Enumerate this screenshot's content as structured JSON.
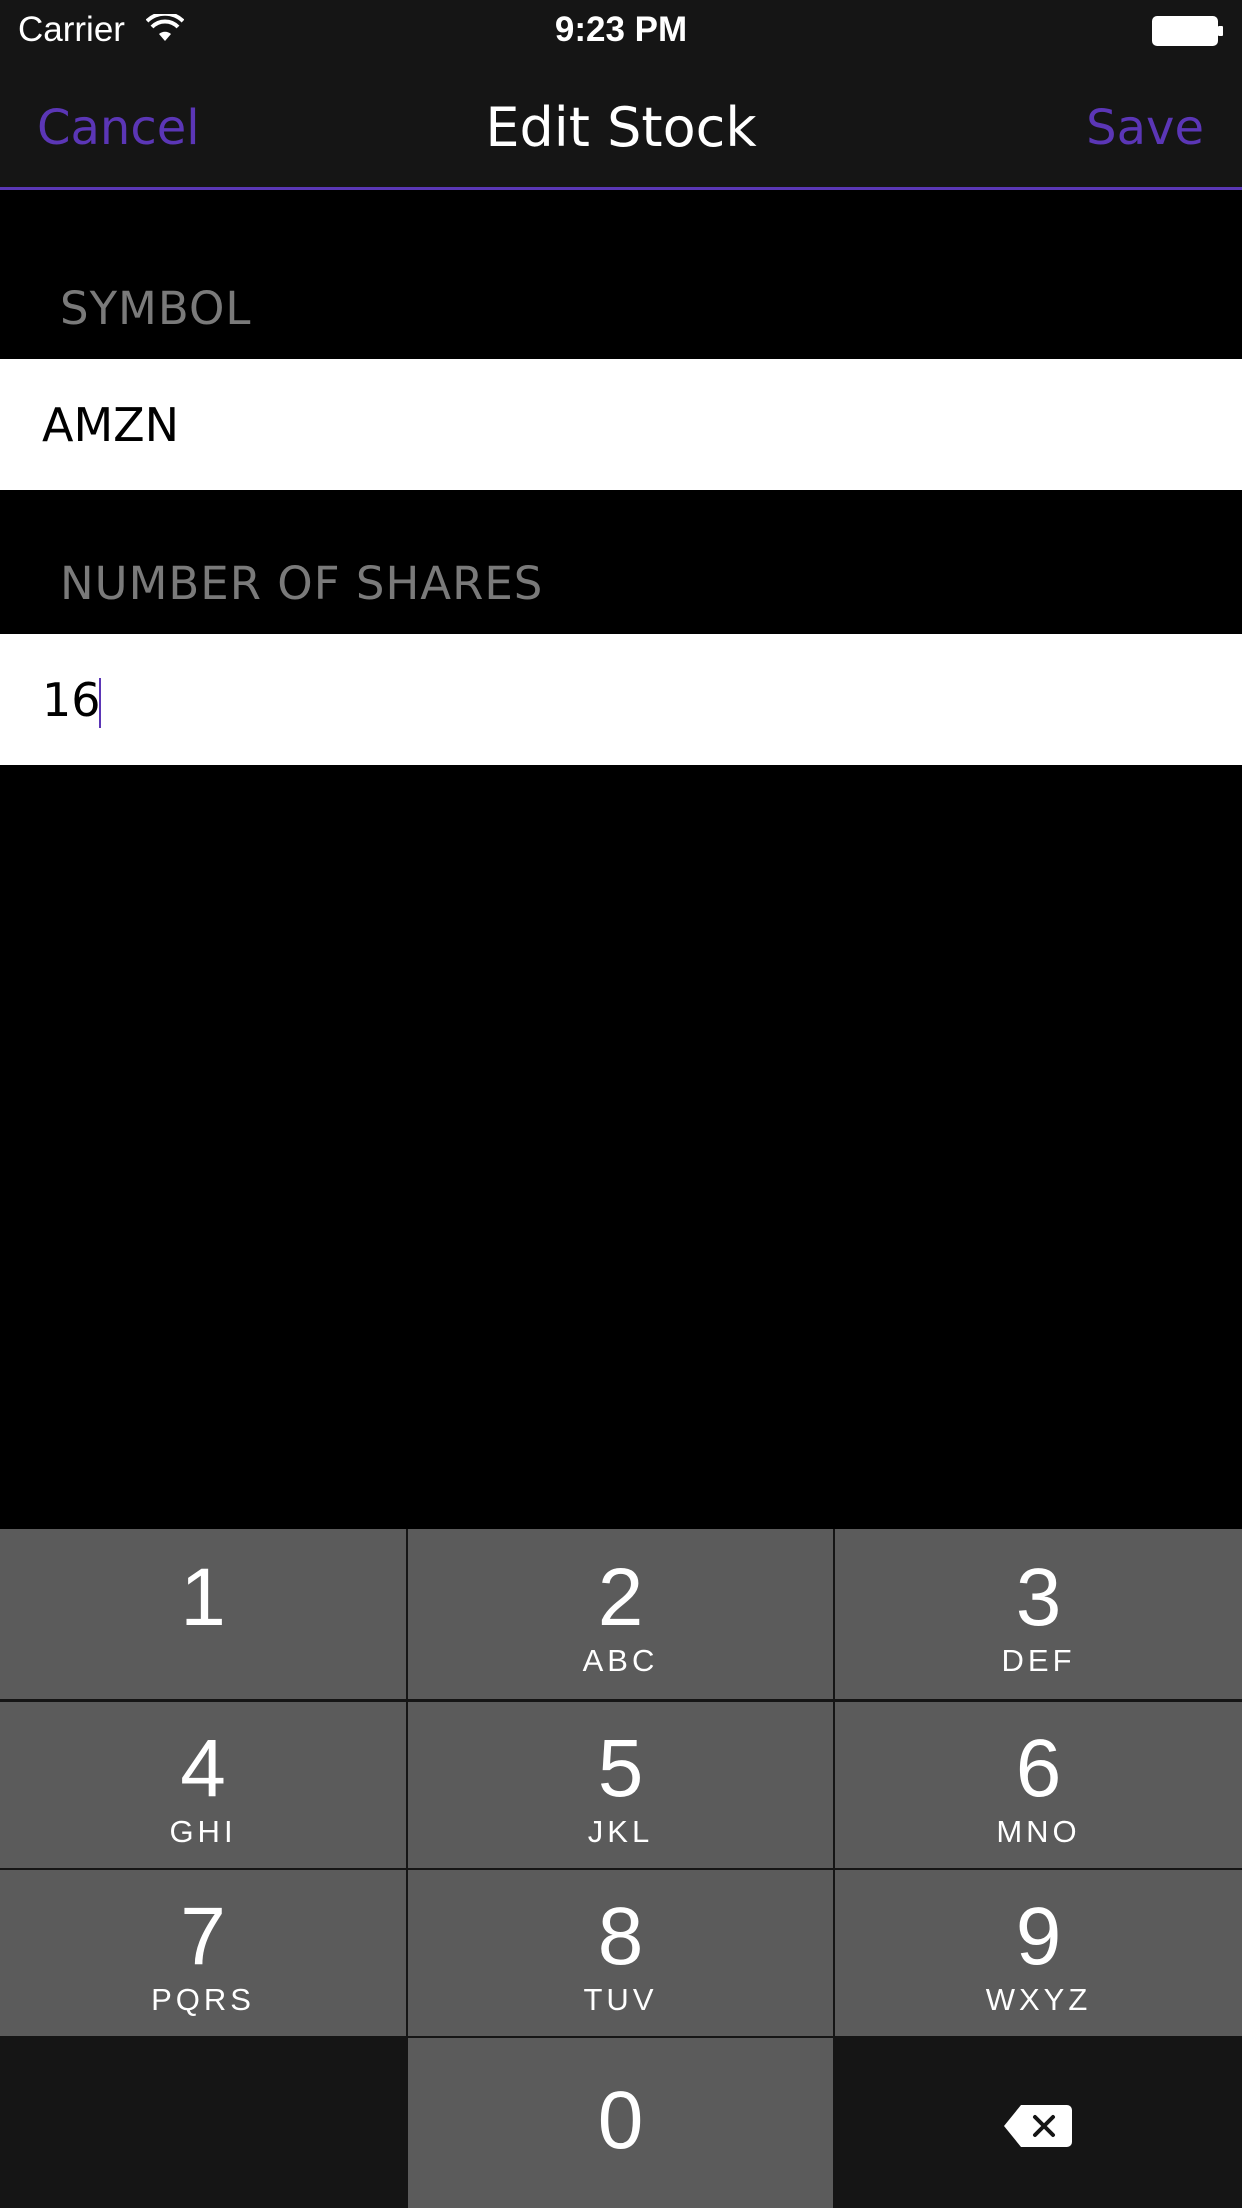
{
  "status_bar": {
    "carrier": "Carrier",
    "time": "9:23 PM",
    "icons": [
      "wifi-icon",
      "battery-icon"
    ]
  },
  "nav": {
    "cancel_label": "Cancel",
    "title": "Edit Stock",
    "save_label": "Save",
    "accent_color": "#5b36b6"
  },
  "form": {
    "symbol_header": "SYMBOL",
    "symbol_value": "AMZN",
    "shares_header": "NUMBER OF SHARES",
    "shares_value": "16"
  },
  "keyboard": {
    "keys": [
      {
        "digit": "1",
        "letters": ""
      },
      {
        "digit": "2",
        "letters": "ABC"
      },
      {
        "digit": "3",
        "letters": "DEF"
      },
      {
        "digit": "4",
        "letters": "GHI"
      },
      {
        "digit": "5",
        "letters": "JKL"
      },
      {
        "digit": "6",
        "letters": "MNO"
      },
      {
        "digit": "7",
        "letters": "PQRS"
      },
      {
        "digit": "8",
        "letters": "TUV"
      },
      {
        "digit": "9",
        "letters": "WXYZ"
      },
      {
        "digit": "0",
        "letters": ""
      }
    ],
    "delete_icon": "delete-backspace-icon"
  }
}
